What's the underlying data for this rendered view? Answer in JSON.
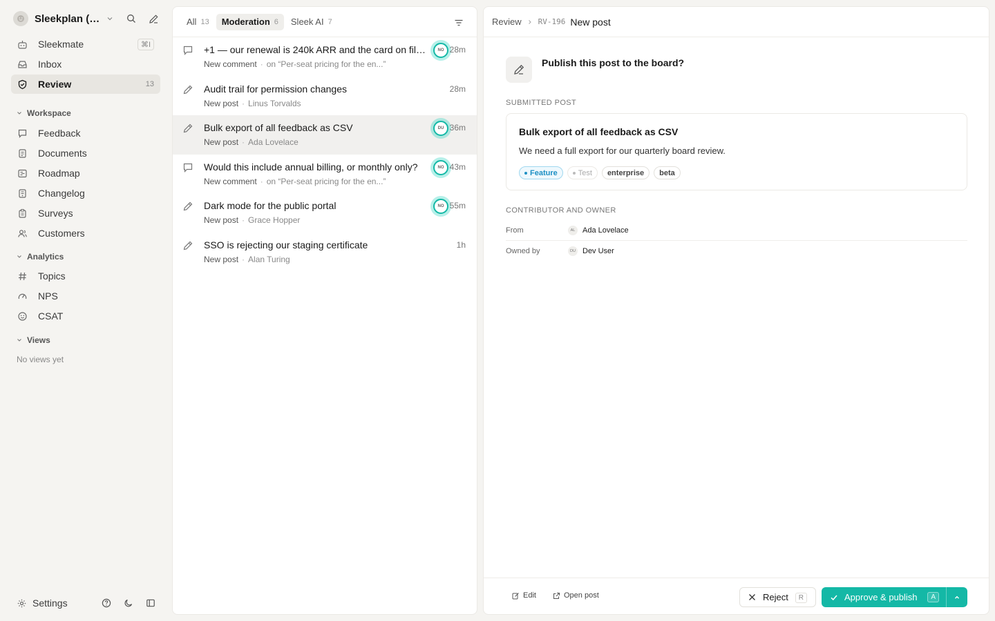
{
  "workspace": {
    "name": "Sleekplan (D...",
    "avatar_icon": "smiley-icon"
  },
  "nav": {
    "sleekmate": {
      "label": "Sleekmate",
      "shortcut": "⌘I"
    },
    "inbox": {
      "label": "Inbox"
    },
    "review": {
      "label": "Review",
      "count": "13"
    }
  },
  "sections": {
    "workspace": "Workspace",
    "analytics": "Analytics",
    "views": "Views",
    "no_views": "No views yet"
  },
  "workspace_items": [
    "Feedback",
    "Documents",
    "Roadmap",
    "Changelog",
    "Surveys",
    "Customers"
  ],
  "analytics_items": [
    "Topics",
    "NPS",
    "CSAT"
  ],
  "settings_label": "Settings",
  "tabs": [
    {
      "label": "All",
      "count": "13"
    },
    {
      "label": "Moderation",
      "count": "6"
    },
    {
      "label": "Sleek AI",
      "count": "7"
    }
  ],
  "list": [
    {
      "title": "+1 — our renewal is 240k ARR and the card on file i...",
      "type": "New comment",
      "meta": "on “Per-seat pricing for the en...”",
      "time": "28m",
      "badge": "NO",
      "icon": "comment-icon"
    },
    {
      "title": "Audit trail for permission changes",
      "type": "New post",
      "meta": "Linus Torvalds",
      "time": "28m",
      "badge": "",
      "icon": "pencil-icon"
    },
    {
      "title": "Bulk export of all feedback as CSV",
      "type": "New post",
      "meta": "Ada Lovelace",
      "time": "36m",
      "badge": "DU",
      "icon": "pencil-icon"
    },
    {
      "title": "Would this include annual billing, or monthly only?",
      "type": "New comment",
      "meta": "on “Per-seat pricing for the en...”",
      "time": "43m",
      "badge": "NO",
      "icon": "comment-icon"
    },
    {
      "title": "Dark mode for the public portal",
      "type": "New post",
      "meta": "Grace Hopper",
      "time": "55m",
      "badge": "NO",
      "icon": "pencil-icon"
    },
    {
      "title": "SSO is rejecting our staging certificate",
      "type": "New post",
      "meta": "Alan Turing",
      "time": "1h",
      "badge": "",
      "icon": "pencil-icon"
    }
  ],
  "detail": {
    "breadcrumb_root": "Review",
    "breadcrumb_id": "RV-196",
    "breadcrumb_current": "New post",
    "prompt": "Publish this post to the board?",
    "submitted_label": "SUBMITTED POST",
    "post_title": "Bulk export of all feedback as CSV",
    "post_body": "We need a full export for our quarterly board review.",
    "tags": [
      "Feature",
      "Test",
      "enterprise",
      "beta"
    ],
    "contributor_label": "CONTRIBUTOR AND OWNER",
    "from_label": "From",
    "from_initials": "AL",
    "from_name": "Ada Lovelace",
    "owner_label": "Owned by",
    "owner_initials": "DU",
    "owner_name": "Dev User"
  },
  "footer": {
    "edit": "Edit",
    "open_post": "Open post",
    "reject": "Reject",
    "reject_key": "R",
    "approve": "Approve & publish",
    "approve_key": "A"
  },
  "colors": {
    "accent": "#14b8a6",
    "feature_tag": "#1c8fc4",
    "selected_row": "#f1f0ee"
  }
}
